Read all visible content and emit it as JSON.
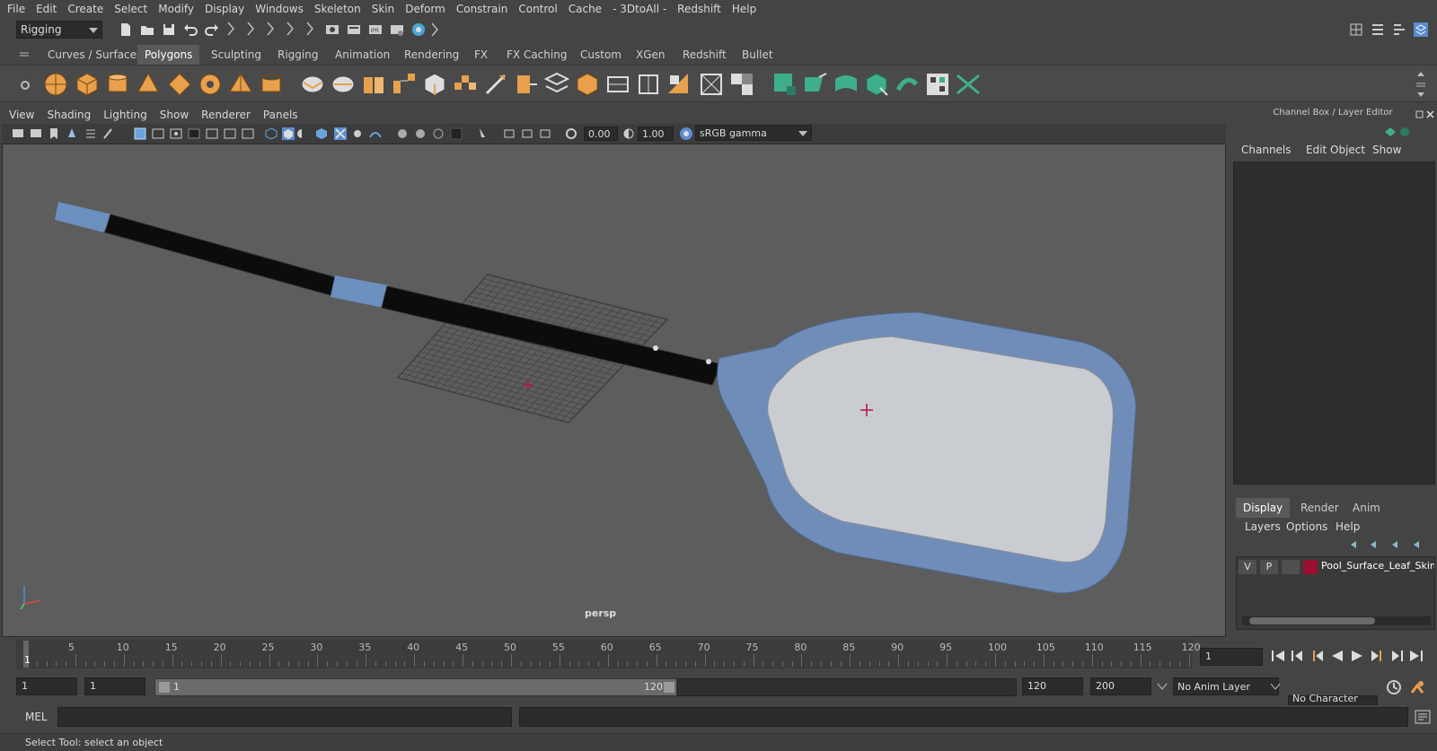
{
  "menubar": [
    "File",
    "Edit",
    "Create",
    "Select",
    "Modify",
    "Display",
    "Windows",
    "Skeleton",
    "Skin",
    "Deform",
    "Constrain",
    "Control",
    "Cache",
    "- 3DtoAll -",
    "Redshift",
    "Help"
  ],
  "status": {
    "menu_set": "Rigging"
  },
  "shelf_tabs": [
    "Curves / Surfaces",
    "Polygons",
    "Sculpting",
    "Rigging",
    "Animation",
    "Rendering",
    "FX",
    "FX Caching",
    "Custom",
    "XGen",
    "Redshift",
    "Bullet"
  ],
  "shelf_active": "Polygons",
  "viewport": {
    "menu": [
      "View",
      "Shading",
      "Lighting",
      "Show",
      "Renderer",
      "Panels"
    ],
    "exposure": "0.00",
    "gamma": "1.00",
    "color_space": "sRGB gamma",
    "camera_label": "persp"
  },
  "channel_box": {
    "title": "Channel Box / Layer Editor",
    "menu": [
      "Channels",
      "Edit",
      "Object",
      "Show"
    ]
  },
  "layer_editor": {
    "tabs": [
      "Display",
      "Render",
      "Anim"
    ],
    "active_tab": "Display",
    "menu": [
      "Layers",
      "Options",
      "Help"
    ],
    "layer": {
      "visible": "V",
      "playback": "P",
      "name": "Pool_Surface_Leaf_Skimmer",
      "color": "#9b1030"
    }
  },
  "timeline": {
    "ticks": [
      "5",
      "10",
      "15",
      "20",
      "25",
      "30",
      "35",
      "40",
      "45",
      "50",
      "55",
      "60",
      "65",
      "70",
      "75",
      "80",
      "85",
      "90",
      "95",
      "100",
      "105",
      "110",
      "115",
      "120"
    ],
    "current_frame_marker": "1",
    "current_frame": "1"
  },
  "range": {
    "start": "1",
    "playback_start": "1",
    "slider_start": "1",
    "slider_end": "120",
    "playback_end": "120",
    "end": "200",
    "anim_layer": "No Anim Layer",
    "character_set": "No Character Set"
  },
  "command": {
    "language": "MEL"
  },
  "help_line": "Select Tool: select an object",
  "colors": {
    "bg": "#444444",
    "viewport": "#5d5d5d",
    "accent_blue": "#5a8ccf",
    "shelf_orange": "#e8a04c",
    "shelf_green": "#3fae8c"
  }
}
